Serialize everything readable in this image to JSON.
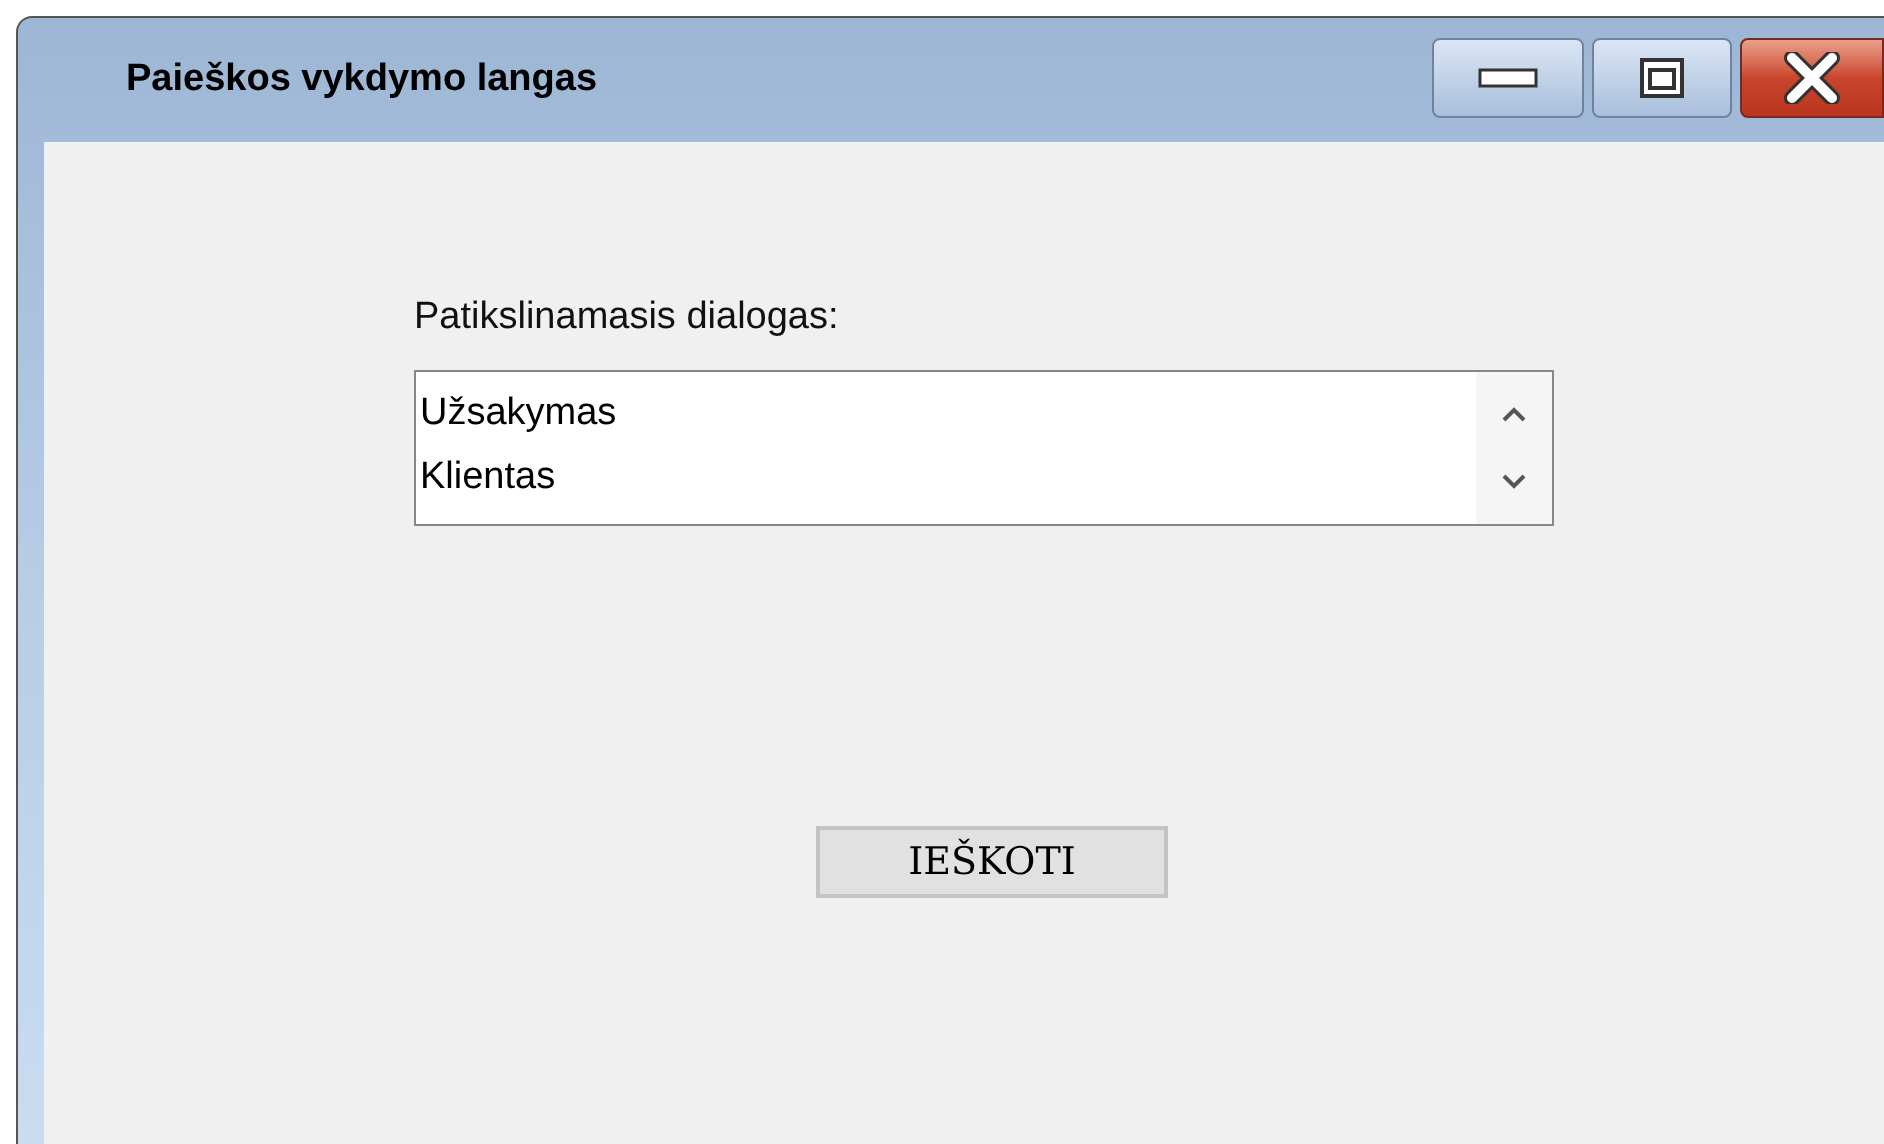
{
  "window": {
    "title": "Paieškos vykdymo langas"
  },
  "label": "Patikslinamasis dialogas:",
  "list": {
    "items": [
      {
        "text": "Užsakymas"
      },
      {
        "text": "Klientas"
      }
    ]
  },
  "button": "IEŠKOTI"
}
